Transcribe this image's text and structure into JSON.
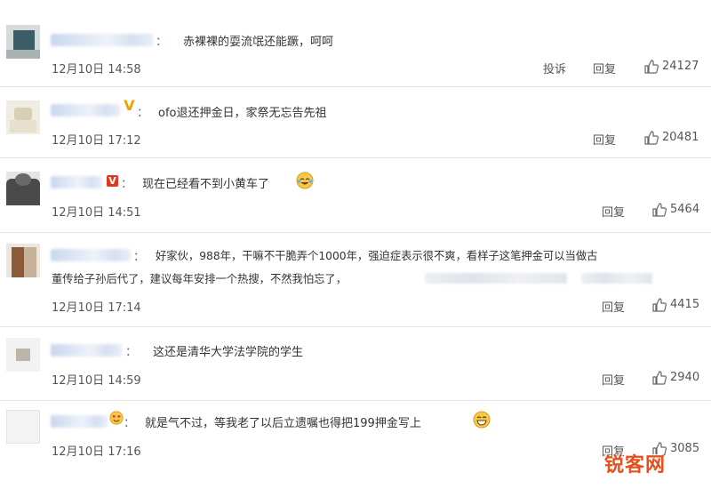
{
  "comments": [
    {
      "text": "赤裸裸的耍流氓还能蹶，呵呵",
      "time": "12月10日 14:58",
      "report_label": "投诉",
      "reply_label": "回复",
      "likes": "24127"
    },
    {
      "text": "ofo退还押金日，家祭无忘告先祖",
      "time": "12月10日 17:12",
      "reply_label": "回复",
      "likes": "20481"
    },
    {
      "text": "现在已经看不到小黄车了",
      "time": "12月10日 14:51",
      "reply_label": "回复",
      "likes": "5464"
    },
    {
      "text_line1": "好家伙，988年，干嘛不干脆弄个1000年，强迫症表示很不爽，看样子这笔押金可以当做古",
      "text_line2": "董传给子孙后代了，建议每年安排一个热搜，不然我怕忘了，",
      "time": "12月10日 17:14",
      "reply_label": "回复",
      "likes": "4415"
    },
    {
      "text": "这还是清华大学法学院的学生",
      "time": "12月10日 14:59",
      "reply_label": "回复",
      "likes": "2940"
    },
    {
      "text": "就是气不过，等我老了以后立遗嘱也得把199押金写上",
      "time": "12月10日 17:16",
      "reply_label": "回复",
      "likes": "3085"
    }
  ],
  "watermark": "锐客网",
  "colors": {
    "like_icon": "#666666",
    "vip_gold": "#f0a000",
    "vip_red": "#e2391b",
    "watermark": "#e7501d"
  }
}
